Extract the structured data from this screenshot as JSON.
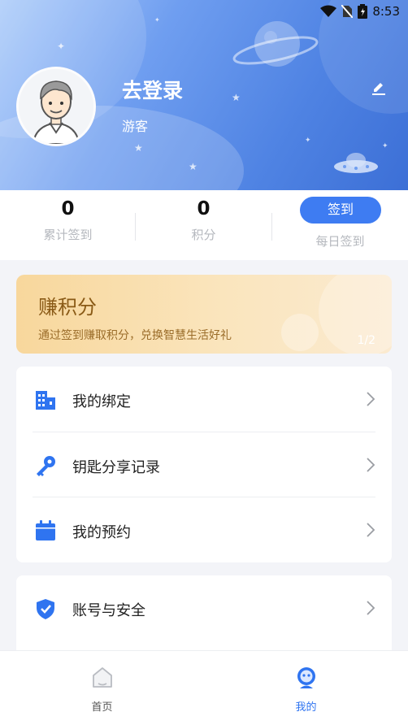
{
  "status_bar": {
    "time": "8:53"
  },
  "profile": {
    "title": "去登录",
    "subtitle": "游客"
  },
  "stats": {
    "total_checkin": {
      "value": "0",
      "label": "累计签到"
    },
    "points": {
      "value": "0",
      "label": "积分"
    },
    "daily_checkin": {
      "button_label": "签到",
      "label": "每日签到"
    }
  },
  "banner": {
    "title": "赚积分",
    "subtitle": "通过签到赚取积分，兑换智慧生活好礼",
    "pager": "1/2"
  },
  "menu_group_1": [
    {
      "label": "我的绑定",
      "icon": "building-icon"
    },
    {
      "label": "钥匙分享记录",
      "icon": "key-icon"
    },
    {
      "label": "我的预约",
      "icon": "calendar-icon"
    }
  ],
  "menu_group_2": [
    {
      "label": "账号与安全",
      "icon": "shield-icon"
    }
  ],
  "tabbar": {
    "home_label": "首页",
    "mine_label": "我的"
  },
  "colors": {
    "accent": "#3e7cf2",
    "banner_text": "#8a5a16",
    "header_gradient_start": "#aecdfa",
    "header_gradient_end": "#3c6fd6"
  }
}
